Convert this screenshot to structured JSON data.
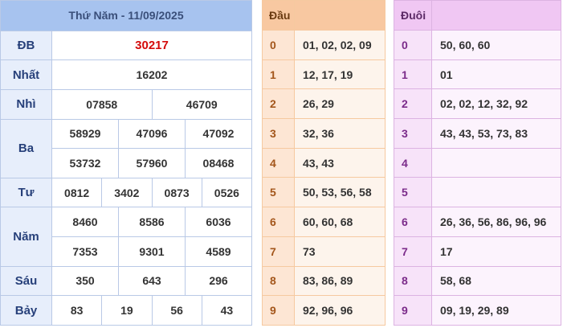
{
  "results": {
    "title": "Thứ Năm - 11/09/2025",
    "labels": {
      "db": "ĐB",
      "nhat": "Nhất",
      "nhi": "Nhì",
      "ba": "Ba",
      "tu": "Tư",
      "nam": "Năm",
      "sau": "Sáu",
      "bay": "Bảy"
    },
    "db": "30217",
    "nhat": "16202",
    "nhi": [
      "07858",
      "46709"
    ],
    "ba": [
      "58929",
      "47096",
      "47092",
      "53732",
      "57960",
      "08468"
    ],
    "tu": [
      "0812",
      "3402",
      "0873",
      "0526"
    ],
    "nam": [
      "8460",
      "8586",
      "6036",
      "7353",
      "9301",
      "4589"
    ],
    "sau": [
      "350",
      "643",
      "296"
    ],
    "bay": [
      "83",
      "19",
      "56",
      "43"
    ]
  },
  "dau": {
    "header": "Đầu",
    "rows": [
      {
        "k": "0",
        "v": "01, 02, 02, 09"
      },
      {
        "k": "1",
        "v": "12, 17, 19"
      },
      {
        "k": "2",
        "v": "26, 29"
      },
      {
        "k": "3",
        "v": "32, 36"
      },
      {
        "k": "4",
        "v": "43, 43"
      },
      {
        "k": "5",
        "v": "50, 53, 56, 58"
      },
      {
        "k": "6",
        "v": "60, 60, 68"
      },
      {
        "k": "7",
        "v": "73"
      },
      {
        "k": "8",
        "v": "83, 86, 89"
      },
      {
        "k": "9",
        "v": "92, 96, 96"
      }
    ]
  },
  "duoi": {
    "header": "Đuôi",
    "rows": [
      {
        "k": "0",
        "v": "50, 60, 60"
      },
      {
        "k": "1",
        "v": "01"
      },
      {
        "k": "2",
        "v": "02, 02, 12, 32, 92"
      },
      {
        "k": "3",
        "v": "43, 43, 53, 73, 83"
      },
      {
        "k": "4",
        "v": ""
      },
      {
        "k": "5",
        "v": ""
      },
      {
        "k": "6",
        "v": "26, 36, 56, 86, 96, 96"
      },
      {
        "k": "7",
        "v": "17"
      },
      {
        "k": "8",
        "v": "58, 68"
      },
      {
        "k": "9",
        "v": "09, 19, 29, 89"
      }
    ]
  }
}
